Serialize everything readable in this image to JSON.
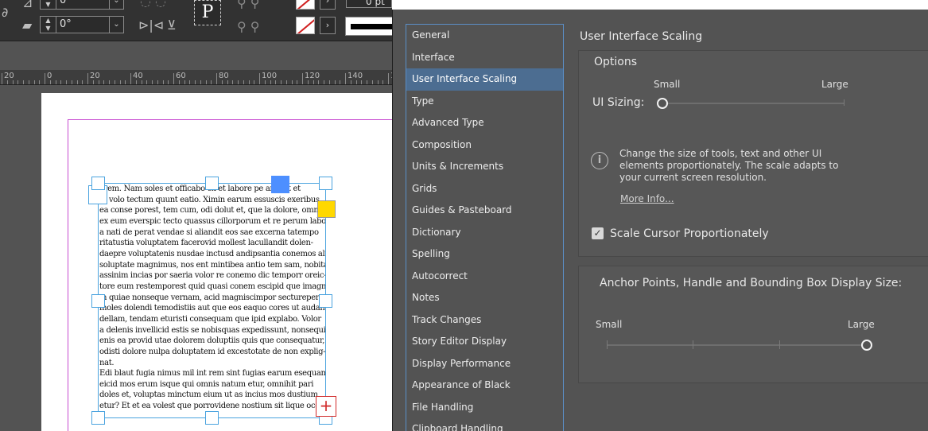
{
  "toolbar": {
    "field_top_value": "0°",
    "field_bottom_value": "0°",
    "paragraph_glyph": "P",
    "stroke_weight_value": "0 pt"
  },
  "ruler": {
    "labels": [
      "20",
      "0",
      "20",
      "40",
      "60",
      "80",
      "100",
      "120",
      "140",
      "160"
    ]
  },
  "document": {
    "body_lines": [
      "l rem. Nam soles et officabo ex et labore pe andisit et",
      "m volo tectum quunt eatio. Ximin earum essuscis exeribus",
      "ea conse porest, tem cum, odi dolut et, que la dolore, ommo",
      "ex eum everspic tecto quassus cillorporum et re perum labor",
      "a nati de perat vendae si aliandit eos sae excerna tatempo",
      "ritatustia voluptatem facerovid mollest lacullandit dolen-",
      "daepre voluptatenis nusdae inctusd andipsantia conemos alici",
      "soluptate magnimus, nos ent mintibea antio tem sam, nobitas",
      "assinim incias por saeria volor re conemo dic temporr oreic-",
      "tore eum restemporest quid quasi conem escipid que imagnam",
      "m quiae nonseque vernam, acid magniscimpor secturepero",
      "moles dolendi temodistiis aut que eos eaquo cores ut audan-",
      "dellam, tendam eturisti consequam que ipid explabo. Volor",
      "a delenis invellicid estis se nobisquas expedissunt, nonsequia",
      "enis ea provid utae dolorem doluptiis quis que consequatur,",
      "odisti dolore nulpa doluptatem id excestotate de non explig-",
      "nat.",
      "Edi blaut fugia nimus mil int rem sint fugias earum esequam",
      "eicid mos erum isque qui omnis natum etur, omnihit pari",
      "doles et, voluptas minctum eium ut as incius mos dustium",
      "etur? Et et ea volest que porrovidene nostium sit lique occ"
    ],
    "overset_glyph": "+"
  },
  "preferences": {
    "categories": [
      {
        "label": "General"
      },
      {
        "label": "Interface"
      },
      {
        "label": "User Interface Scaling",
        "selected": true
      },
      {
        "label": "Type"
      },
      {
        "label": "Advanced Type"
      },
      {
        "label": "Composition"
      },
      {
        "label": "Units & Increments"
      },
      {
        "label": "Grids"
      },
      {
        "label": "Guides & Pasteboard"
      },
      {
        "label": "Dictionary"
      },
      {
        "label": "Spelling"
      },
      {
        "label": "Autocorrect"
      },
      {
        "label": "Notes"
      },
      {
        "label": "Track Changes"
      },
      {
        "label": "Story Editor Display"
      },
      {
        "label": "Display Performance"
      },
      {
        "label": "Appearance of Black"
      },
      {
        "label": "File Handling"
      },
      {
        "label": "Clipboard Handling"
      }
    ],
    "section_title": "User Interface Scaling",
    "options_legend": "Options",
    "ui_sizing": {
      "label": "UI Sizing:",
      "min_label": "Small",
      "max_label": "Large",
      "level": 0.0
    },
    "info_icon_glyph": "i",
    "info_text": "Change the size of tools, text and other UI elements proportionately. The scale adapts to your current screen resolution.",
    "more_info_link": "More Info...",
    "scale_cursor": {
      "label": "Scale Cursor Proportionately",
      "checked": true,
      "check_glyph": "✓"
    },
    "anchor": {
      "title": "Anchor Points, Handle and Bounding Box Display Size:",
      "min_label": "Small",
      "max_label": "Large",
      "level": 1.0
    }
  },
  "colors": {
    "selection": "#4c6d91",
    "frame_border": "#4aa3df",
    "margin_guide": "#c74bd0",
    "overset": "#d12a2a"
  }
}
